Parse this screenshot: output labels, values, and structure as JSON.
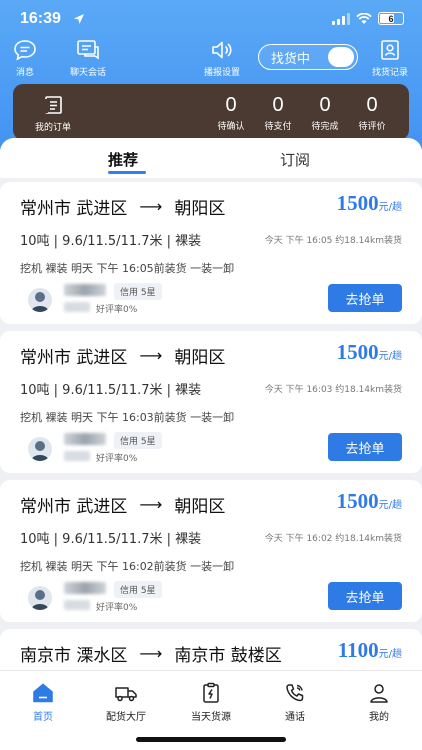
{
  "status_bar": {
    "time": "16:39",
    "battery": "6"
  },
  "top_nav": {
    "messages_label": "消息",
    "chat_label": "聊天会话",
    "broadcast_label": "播报设置",
    "finding_label": "找货中",
    "history_label": "找货记录"
  },
  "orders": {
    "my_orders_label": "我的订单",
    "stats": [
      {
        "value": "0",
        "label": "待确认"
      },
      {
        "value": "0",
        "label": "待支付"
      },
      {
        "value": "0",
        "label": "待完成"
      },
      {
        "value": "0",
        "label": "待评价"
      }
    ]
  },
  "tabs": {
    "recommend": "推荐",
    "subscribe": "订阅"
  },
  "cards": [
    {
      "from": "常州市 武进区",
      "arrow": "⟶",
      "to": "朝阳区",
      "price": "1500",
      "unit": "元/趟",
      "spec": "10吨 | 9.6/11.5/11.7米 | 裸装",
      "when": "今天 下午 16:05 约18.14km装货",
      "desc": "挖机 裸装 明天 下午 16:05前装货 一装一卸",
      "credit": "信用 5星",
      "rate": "好评率0%",
      "button": "去抢单"
    },
    {
      "from": "常州市 武进区",
      "arrow": "⟶",
      "to": "朝阳区",
      "price": "1500",
      "unit": "元/趟",
      "spec": "10吨 | 9.6/11.5/11.7米 | 裸装",
      "when": "今天 下午 16:03 约18.14km装货",
      "desc": "挖机 裸装 明天 下午 16:03前装货 一装一卸",
      "credit": "信用 5星",
      "rate": "好评率0%",
      "button": "去抢单"
    },
    {
      "from": "常州市 武进区",
      "arrow": "⟶",
      "to": "朝阳区",
      "price": "1500",
      "unit": "元/趟",
      "spec": "10吨 | 9.6/11.5/11.7米 | 裸装",
      "when": "今天 下午 16:02 约18.14km装货",
      "desc": "挖机 裸装 明天 下午 16:02前装货 一装一卸",
      "credit": "信用 5星",
      "rate": "好评率0%",
      "button": "去抢单"
    },
    {
      "from": "南京市 溧水区",
      "arrow": "⟶",
      "to": "南京市 鼓楼区",
      "price": "1100",
      "unit": "元/趟"
    }
  ],
  "bottom_nav": {
    "home": "首页",
    "cargo_hall": "配货大厅",
    "today_source": "当天货源",
    "calls": "通话",
    "mine": "我的"
  },
  "colors": {
    "accent": "#2f7be6",
    "hero": "#3e8ef2",
    "order_box": "#4b3a31"
  }
}
